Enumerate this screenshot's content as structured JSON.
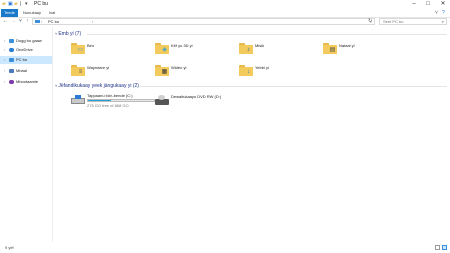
{
  "window": {
    "title": "PC bu"
  },
  "window_controls": {
    "minimize": "–",
    "maximize": "□",
    "close": "✕"
  },
  "quick_access": {
    "sep": "|",
    "arrow": "▾"
  },
  "ribbon": {
    "tabs": [
      "Teedé",
      "Nonukaay",
      "Ixal"
    ],
    "expand_icon": "˅",
    "help_icon": "?"
  },
  "address": {
    "back": "←",
    "forward": "→",
    "recent": "˅",
    "up": "↑",
    "crumb_arrow": "›",
    "path": "PC bu",
    "dropdown": "˅",
    "refresh": "↻",
    "search_placeholder": "Seet PC bu",
    "search_icon": "⌕"
  },
  "sidebar": {
    "items": [
      {
        "label": "Dugg bu gaaw",
        "icon": "star-icon",
        "color": "#3c8fd8",
        "chev": "›"
      },
      {
        "label": "OneDrive",
        "icon": "cloud-icon",
        "color": "#2a7fd4",
        "chev": "›"
      },
      {
        "label": "PC bu",
        "icon": "computer-icon",
        "color": "#3c8fd8",
        "chev": "›",
        "selected": true
      },
      {
        "label": "Mbaal",
        "icon": "network-icon",
        "color": "#4a7ab8",
        "chev": "›"
      },
      {
        "label": "Mbootaamle",
        "icon": "homegroup-icon",
        "color": "#7b3aa8",
        "chev": "›"
      }
    ]
  },
  "groups": {
    "folders_title": "Emb yi (7)",
    "devices_title": "Jëfandikukaay yeek jàngukaay yi (2)",
    "arrow": "˅"
  },
  "folders": [
    {
      "label": "Biro",
      "glyph": "▭",
      "glyph_color": "#3c8fd8"
    },
    {
      "label": "Këf yu 3D yi",
      "glyph": "◈",
      "glyph_color": "#2a9bd9"
    },
    {
      "label": "Misik",
      "glyph": "♪",
      "glyph_color": "#1e5aa8"
    },
    {
      "label": "Nataal yi",
      "glyph": "▤",
      "glyph_color": "#444444"
    },
    {
      "label": "Wayndare yi",
      "glyph": "≡",
      "glyph_color": "#555555"
    },
    {
      "label": "Widéo yi",
      "glyph": "▦",
      "glyph_color": "#333333"
    },
    {
      "label": "Yebbi yi",
      "glyph": "↓",
      "glyph_color": "#1e6fd8"
    }
  ],
  "devices": [
    {
      "label": "Tappaanu bön-bende (C:)",
      "sub": "275 GO free of 868 GO",
      "fill_fraction": 0.35
    },
    {
      "label": "Dewaltukaayu DVD RW (D:)"
    }
  ],
  "status": {
    "count": "9 yéf"
  }
}
